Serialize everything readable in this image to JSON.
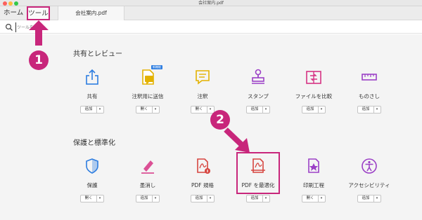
{
  "window": {
    "title": "会社案内.pdf"
  },
  "tabs": {
    "home": "ホーム",
    "tools": "ツール",
    "document": "会社案内.pdf"
  },
  "search": {
    "placeholder": "ツールを検索"
  },
  "sections": {
    "share": {
      "title": "共有とレビュー",
      "tools": [
        {
          "label": "共有",
          "button": "追加",
          "icon": "share-icon"
        },
        {
          "label": "注釈用に送信",
          "button": "開く",
          "icon": "send-for-comments-icon",
          "badge": "新機能"
        },
        {
          "label": "注釈",
          "button": "開く",
          "icon": "comment-icon"
        },
        {
          "label": "スタンプ",
          "button": "追加",
          "icon": "stamp-icon"
        },
        {
          "label": "ファイルを比較",
          "button": "追加",
          "icon": "compare-files-icon"
        },
        {
          "label": "ものさし",
          "button": "追加",
          "icon": "measure-icon"
        }
      ]
    },
    "protect": {
      "title": "保護と標準化",
      "tools": [
        {
          "label": "保護",
          "button": "開く",
          "icon": "protect-shield-icon"
        },
        {
          "label": "墨消し",
          "button": "追加",
          "icon": "redact-icon"
        },
        {
          "label": "PDF 規格",
          "button": "追加",
          "icon": "pdf-standards-icon"
        },
        {
          "label": "PDF を最適化",
          "button": "追加",
          "icon": "optimize-pdf-icon"
        },
        {
          "label": "印刷工程",
          "button": "開く",
          "icon": "print-production-icon"
        },
        {
          "label": "アクセシビリティ",
          "button": "追加",
          "icon": "accessibility-icon"
        }
      ]
    }
  },
  "dropdown_arrow": "▾",
  "annotations": {
    "step1": "1",
    "step2": "2"
  },
  "colors": {
    "highlight": "#c8267b",
    "blue": "#2d7de0",
    "yellow": "#e3b200",
    "purple": "#9b40c6",
    "pink": "#d63384",
    "red": "#d6453f"
  }
}
